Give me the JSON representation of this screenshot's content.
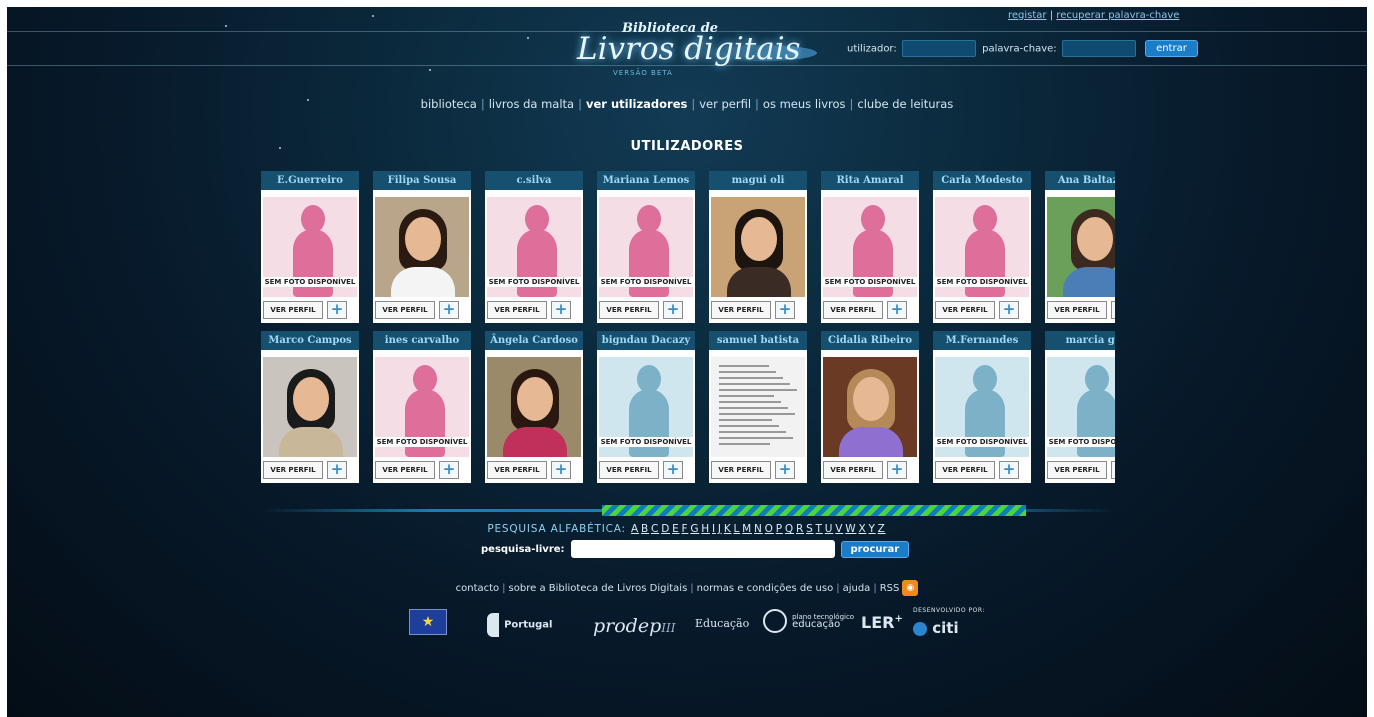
{
  "logo": {
    "top": "Biblioteca de",
    "main": "Livros digitais",
    "beta": "VERSÃO BETA"
  },
  "toplinks": {
    "register": "registar",
    "recover": "recuperar palavra-chave",
    "sep": "|"
  },
  "login": {
    "user_label": "utilizador:",
    "pass_label": "palavra-chave:",
    "button": "entrar"
  },
  "nav": [
    {
      "label": "biblioteca",
      "active": false
    },
    {
      "label": "livros da malta",
      "active": false
    },
    {
      "label": "ver utilizadores",
      "active": true
    },
    {
      "label": "ver perfil",
      "active": false
    },
    {
      "label": "os meus livros",
      "active": false
    },
    {
      "label": "clube de leituras",
      "active": false
    }
  ],
  "page_title": "UTILIZADORES",
  "card_labels": {
    "no_photo": "SEM FOTO DISPONÍVEL",
    "view_profile": "VER PERFIL",
    "add": "+"
  },
  "users": [
    {
      "name": "E.Guerreiro",
      "photo": "none-female"
    },
    {
      "name": "Filipa Sousa",
      "photo": "real"
    },
    {
      "name": "c.silva",
      "photo": "none-female"
    },
    {
      "name": "Mariana Lemos",
      "photo": "none-female"
    },
    {
      "name": "magui oli",
      "photo": "real"
    },
    {
      "name": "Rita Amaral",
      "photo": "none-female"
    },
    {
      "name": "Carla Modesto",
      "photo": "none-female"
    },
    {
      "name": "Ana Baltazar",
      "photo": "real"
    },
    {
      "name": "Marco Campos",
      "photo": "real"
    },
    {
      "name": "ines carvalho",
      "photo": "none-female"
    },
    {
      "name": "Ângela Cardoso",
      "photo": "real"
    },
    {
      "name": "bigndau Dacazy",
      "photo": "none-male"
    },
    {
      "name": "samuel batista",
      "photo": "document"
    },
    {
      "name": "Cidalia Ribeiro",
      "photo": "real"
    },
    {
      "name": "M.Fernandes",
      "photo": "none-male"
    },
    {
      "name": "marcia gil",
      "photo": "none-male"
    }
  ],
  "alpha_search": {
    "label": "PESQUISA ALFABÉTICA:",
    "letters": [
      "A",
      "B",
      "C",
      "D",
      "E",
      "F",
      "G",
      "H",
      "I",
      "J",
      "K",
      "L",
      "M",
      "N",
      "O",
      "P",
      "Q",
      "R",
      "S",
      "T",
      "U",
      "V",
      "W",
      "X",
      "Y",
      "Z"
    ]
  },
  "free_search": {
    "label": "pesquisa-livre:",
    "value": "",
    "button": "procurar"
  },
  "footer_links": [
    "contacto",
    "sobre a Biblioteca de Livros Digitais",
    "normas e condições de uso",
    "ajuda",
    "RSS"
  ],
  "partners": {
    "portugal": "Portugal",
    "prodep": "prodep",
    "prodep_roman": "III",
    "educacao": "Educação",
    "pte_line1": "plano tecnológico",
    "pte_line2": "educação",
    "ler": "LER",
    "dev_by": "DESENVOLVIDO POR:",
    "citi": "citi"
  }
}
